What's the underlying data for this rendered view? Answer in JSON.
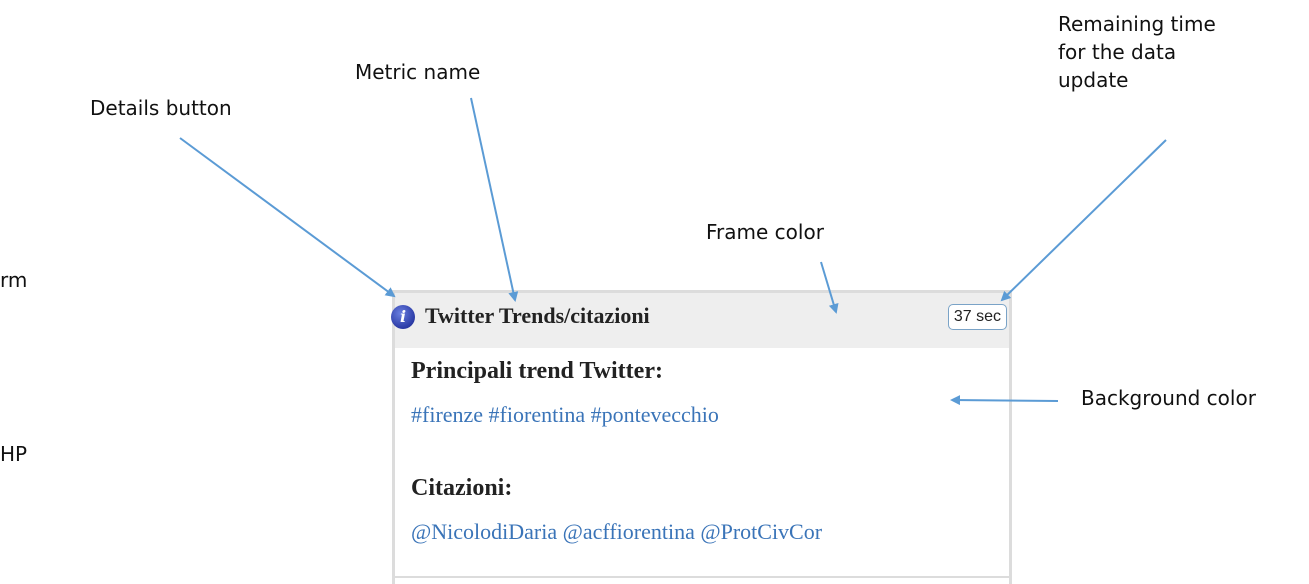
{
  "annotations": {
    "details_button": "Details button",
    "metric_name": "Metric name",
    "remaining_time": "Remaining time\nfor the data\nupdate",
    "frame_color": "Frame color",
    "background_color": "Background color",
    "left_fragment_1": "rm",
    "left_fragment_2": "HP"
  },
  "widget": {
    "info_icon": "i",
    "title": "Twitter Trends/citazioni",
    "countdown": "37 sec",
    "trends_title": "Principali trend Twitter:",
    "trends_values": "#firenze #fiorentina #pontevecchio",
    "citations_title": "Citazioni:",
    "citations_values": "@NicolodiDaria @acffiorentina @ProtCivCor"
  },
  "colors": {
    "frame": "#eeeeee",
    "background": "#ffffff",
    "link": "#3a74b8",
    "arrow": "#5b9bd5"
  }
}
